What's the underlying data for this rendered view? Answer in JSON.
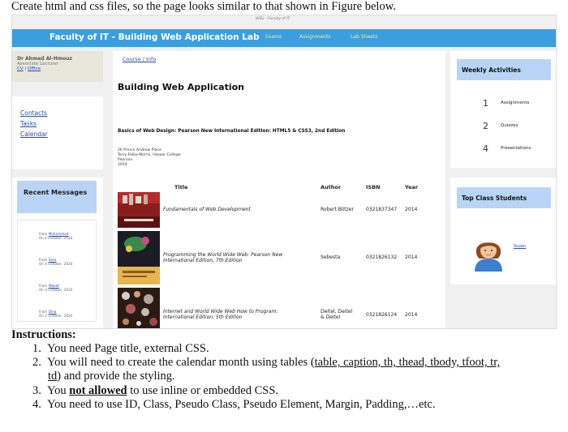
{
  "intro": "Create html and css files, so the page looks similar to that shown in Figure below.",
  "screenshot": {
    "url_text": "WEU - Faculty of IT",
    "header": {
      "title": "Faculty of IT - Building Web Application Lab",
      "nav": [
        "Exams",
        "Assignments",
        "Lab Sheets"
      ]
    },
    "profile": {
      "name": "Dr Ahmed Al-Hmouz",
      "role": "Associate Lecturer",
      "cv": "CV",
      "separator": " | ",
      "office": "Office"
    },
    "side_links": [
      "Contacts",
      "Tasks",
      "Calendar"
    ],
    "messages": {
      "title": "Recent Messages",
      "items": [
        {
          "from": "From",
          "who": "Mohammad",
          "date": "On 4 October, 2020"
        },
        {
          "from": "From",
          "who": "Sara",
          "date": "On 4 October, 2020"
        },
        {
          "from": "From",
          "who": "Waeef",
          "date": "On 3 October, 2020"
        },
        {
          "from": "From",
          "who": "Dina",
          "date": "On 2 October, 2020"
        }
      ]
    },
    "main": {
      "breadcrumb": "Course / Info",
      "heading": "Building Web Application",
      "book_title": "Basics of Web Design: Pearson New International Edition: HTML5 & CSS3, 2nd Edition",
      "book_meta": [
        "26 Prince Andrew Place",
        "Terry Felke-Morris, Harper College",
        "Pearson",
        "2014"
      ],
      "table_headers": {
        "title": "Title",
        "author": "Author",
        "isbn": "ISBN",
        "year": "Year"
      },
      "books": [
        {
          "title": [
            "Fundamentals of Web Development"
          ],
          "author": [
            "Robert Blitzer"
          ],
          "isbn": "0321837347",
          "year": "2014"
        },
        {
          "title": [
            "Programming the World Wide Web: Pearson New",
            "International Edition, 7th Edition"
          ],
          "author": [
            "Sebesta"
          ],
          "isbn": "0321826132",
          "year": "2014"
        },
        {
          "title": [
            "Internet and World Wide Web How to Program:",
            "International Edition, 5th Edition"
          ],
          "author": [
            "Deitel, Deitel",
            "& Deitel"
          ],
          "isbn": "0321826124",
          "year": "2014"
        }
      ]
    },
    "weekly": {
      "title": "Weekly Activities",
      "items": [
        {
          "count": "1",
          "label": "Assignments"
        },
        {
          "count": "2",
          "label": "Quizzes"
        },
        {
          "count": "4",
          "label": "Presentations"
        }
      ]
    },
    "students": {
      "title": "Top Class Students",
      "name": "Suzan"
    }
  },
  "instructions": {
    "title": "Instructions:",
    "items": [
      {
        "num": "1.",
        "text": "You need Page title, external CSS."
      },
      {
        "num": "2.",
        "pre": "You will need to create the calendar month using tables (",
        "under1": "table, caption, th, thead, tbody, tfoot, tr,",
        "under2": "td",
        "post": ") and provide the styling."
      },
      {
        "num": "3.",
        "pre": "You ",
        "bold": "not allowed",
        "post": " to use inline or embedded CSS."
      },
      {
        "num": "4.",
        "text": "You need to use ID, Class, Pseudo Class, Pseudo Element, Margin, Padding,…etc."
      }
    ]
  }
}
